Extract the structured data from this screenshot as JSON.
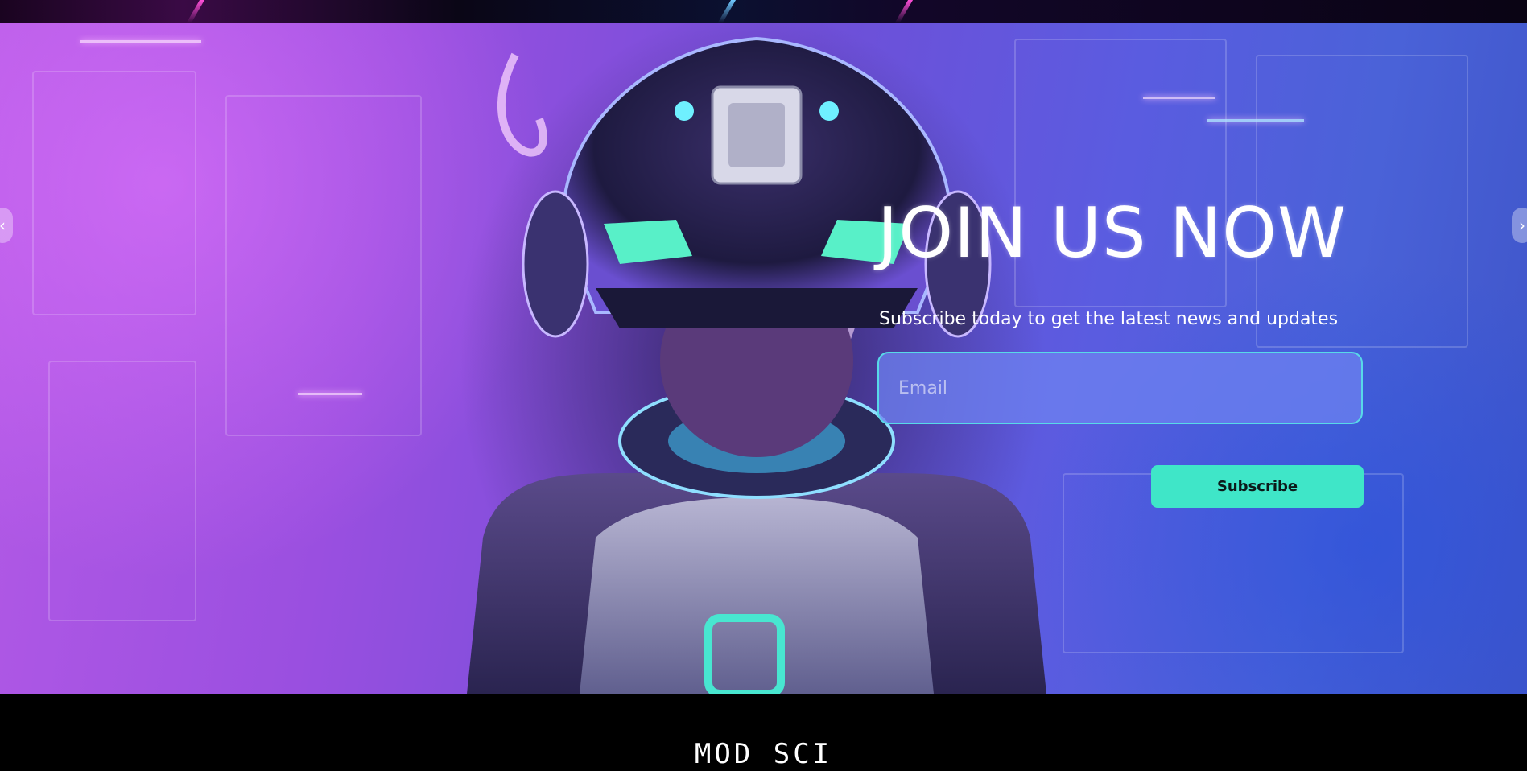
{
  "hero": {
    "title": "JOIN US NOW",
    "subtitle": "Subscribe today to get the latest news and updates",
    "email_placeholder": "Email",
    "email_value": "",
    "subscribe_label": "Subscribe",
    "prev_arrow": "‹",
    "next_arrow": "›"
  },
  "footer": {
    "logo_text": "MOD SCI"
  },
  "colors": {
    "accent": "#3fe6c8",
    "input_border": "#58d9e8",
    "hero_left": "#b45ae6",
    "hero_right": "#3e54c8"
  },
  "icons": {
    "prev": "chevron-left-icon",
    "next": "chevron-right-icon"
  }
}
